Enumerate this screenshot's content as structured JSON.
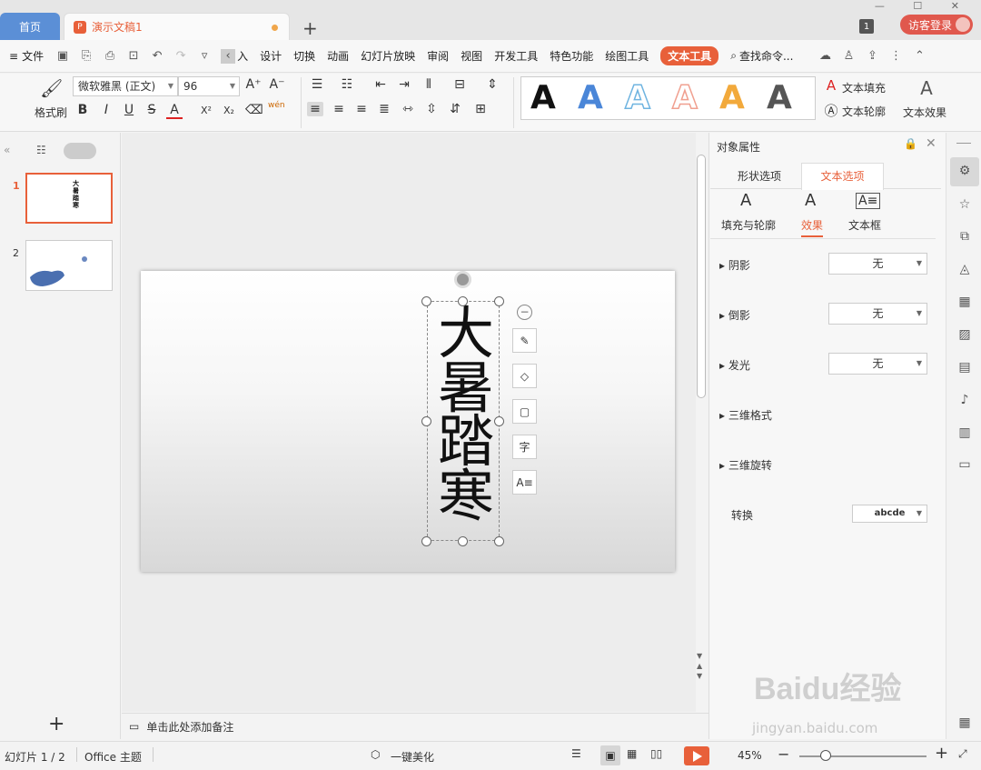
{
  "tabs": {
    "home": "首页",
    "doc_badge": "P",
    "doc": "演示文稿1",
    "add": "+"
  },
  "window": {
    "num": "1",
    "login": "访客登录",
    "controls": "— ☐ ✕"
  },
  "menu": {
    "file": "文件",
    "items": [
      "入",
      "设计",
      "切换",
      "动画",
      "幻灯片放映",
      "审阅",
      "视图",
      "开发工具",
      "特色功能",
      "绘图工具"
    ],
    "texttool": "文本工具",
    "search": "查找命令..."
  },
  "ribbon": {
    "format_painter": "格式刷",
    "font_name": "微软雅黑 (正文)",
    "font_size": "96",
    "bold": "B",
    "italic": "I",
    "underline": "U",
    "strike": "S",
    "fontcolor": "A",
    "superscript": "X²",
    "subscript": "X₂",
    "pinyin": "wén",
    "text_fill": "文本填充",
    "text_outline": "文本轮廓",
    "text_effect": "文本效果",
    "gallery_glyph": "A"
  },
  "colors": {
    "accent": "#e8603a",
    "home_tab": "#5b8fd6",
    "gallery": [
      "#111111",
      "#4a86d8",
      "#6fb4e0",
      "#f0a090",
      "#f2a93b",
      "#555555"
    ]
  },
  "slides": {
    "items": [
      {
        "num": "1"
      },
      {
        "num": "2"
      }
    ],
    "add": "+",
    "thumb_text": "大暑踏寒"
  },
  "canvas": {
    "chars": [
      "大",
      "暑",
      "踏",
      "寒"
    ]
  },
  "notes": {
    "placeholder": "单击此处添加备注"
  },
  "panel": {
    "title": "对象属性",
    "tab_shape": "形状选项",
    "tab_text": "文本选项",
    "sub_fill": "填充与轮廓",
    "sub_effect": "效果",
    "sub_box": "文本框",
    "rows": [
      {
        "label": "阴影",
        "value": "无"
      },
      {
        "label": "倒影",
        "value": "无"
      },
      {
        "label": "发光",
        "value": "无"
      }
    ],
    "threed_format": "三维格式",
    "threed_rotate": "三维旋转",
    "transform": "转换",
    "transform_value": "abcde"
  },
  "status": {
    "slide": "幻灯片 1 / 2",
    "theme": "Office 主题",
    "beautify": "一键美化",
    "zoom": "45%"
  },
  "watermark": {
    "main": "Baidu经验",
    "sub": "jingyan.baidu.com"
  }
}
